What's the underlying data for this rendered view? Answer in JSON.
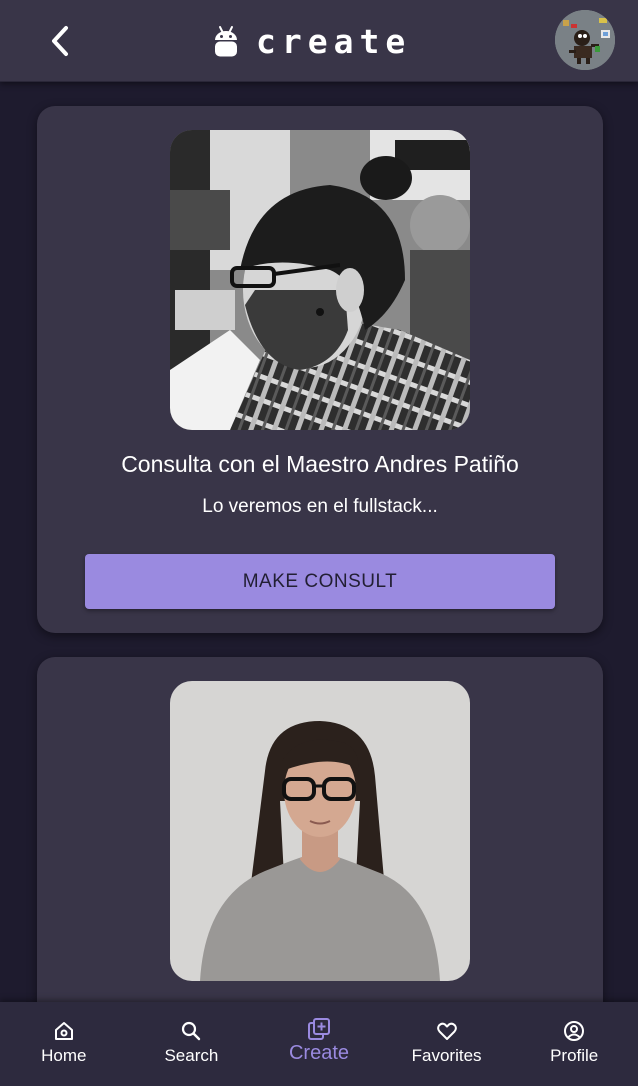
{
  "header": {
    "title": "create",
    "back_icon": "chevron-left-icon",
    "logo_icon": "android-icon",
    "avatar_icon": "user-avatar"
  },
  "cards": [
    {
      "title": "Consulta con el Maestro Andres Patiño",
      "description": "Lo veremos en el fullstack...",
      "button_label": "MAKE CONSULT"
    },
    {
      "title": "",
      "description": "",
      "button_label": ""
    }
  ],
  "nav": {
    "items": [
      {
        "label": "Home",
        "icon": "home-icon",
        "active": false
      },
      {
        "label": "Search",
        "icon": "search-icon",
        "active": false
      },
      {
        "label": "Create",
        "icon": "add-box-icon",
        "active": true
      },
      {
        "label": "Favorites",
        "icon": "heart-icon",
        "active": false
      },
      {
        "label": "Profile",
        "icon": "account-circle-icon",
        "active": false
      }
    ]
  },
  "colors": {
    "background": "#1e1b2e",
    "surface": "#393548",
    "accent": "#9a8ae0",
    "nav_background": "#2d2a3e"
  }
}
